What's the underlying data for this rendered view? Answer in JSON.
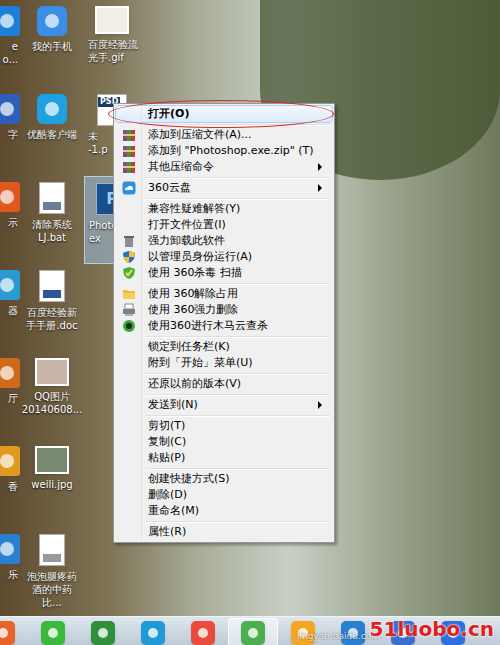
{
  "desktop": {
    "columns": [
      {
        "clipped": true,
        "items": [
          {
            "label": "e\no...",
            "kind": "app",
            "color": "#1d7fd8",
            "selected": false
          },
          {
            "label": "字",
            "kind": "app",
            "color": "#2c5fb8",
            "selected": false
          },
          {
            "label": "示",
            "kind": "app",
            "color": "#e2571e",
            "selected": false
          },
          {
            "label": "器",
            "kind": "app",
            "color": "#2a9ad1",
            "selected": false
          },
          {
            "label": "厅",
            "kind": "app",
            "color": "#d06a1a",
            "selected": false
          },
          {
            "label": "香",
            "kind": "app",
            "color": "#e09a20",
            "selected": false
          },
          {
            "label": "乐",
            "kind": "app",
            "color": "#2a7fd0",
            "selected": false
          }
        ]
      },
      {
        "clipped": false,
        "items": [
          {
            "label": "我的手机",
            "kind": "app",
            "color": "#3a8ee6",
            "selected": false
          },
          {
            "label": "优酷客户端",
            "kind": "app",
            "color": "#1fa0e0",
            "selected": false
          },
          {
            "label": "清除系统\nLJ.bat",
            "kind": "file",
            "color": "#6a7f95",
            "selected": false
          },
          {
            "label": "百度经验新\n手手册.doc",
            "kind": "file",
            "color": "#2b5797",
            "selected": false
          },
          {
            "label": "QQ图片\n20140608...",
            "kind": "image",
            "color": "#c9b6a8",
            "selected": false
          },
          {
            "label": "weili.jpg",
            "kind": "image",
            "color": "#7a8a70",
            "selected": false
          },
          {
            "label": "泡泡腿疼药\n酒的中药比...",
            "kind": "file",
            "color": "#9a9a9a",
            "selected": false
          }
        ]
      },
      {
        "clipped": false,
        "items": [
          {
            "label": "百度经验流\n光手.gif",
            "kind": "image",
            "color": "#f2efe8",
            "selected": false
          },
          {
            "label": "未\n-1.p",
            "kind": "psd",
            "badge": "PSD",
            "color": "#1b3a6b",
            "selected": false
          },
          {
            "label": "Photo\nex",
            "kind": "ps",
            "badge": "P",
            "color": "#1b4f8c",
            "selected": true
          }
        ]
      }
    ]
  },
  "context_menu": {
    "groups": [
      [
        {
          "label": "打开(O)",
          "kind": "plain",
          "submenu": false,
          "selected": true,
          "default": true,
          "annotated": true
        }
      ],
      [
        {
          "label": "添加到压缩文件(A)...",
          "kind": "rar",
          "submenu": false,
          "selected": false,
          "default": false,
          "annotated": false
        },
        {
          "label": "添加到 \"Photoshop.exe.zip\" (T)",
          "kind": "rar",
          "submenu": false,
          "selected": false,
          "default": false,
          "annotated": false
        },
        {
          "label": "其他压缩命令",
          "kind": "rar",
          "submenu": true,
          "selected": false,
          "default": false,
          "annotated": false
        }
      ],
      [
        {
          "label": "360云盘",
          "kind": "cloud",
          "submenu": true,
          "selected": false,
          "default": false,
          "annotated": false
        }
      ],
      [
        {
          "label": "兼容性疑难解答(Y)",
          "kind": "plain",
          "submenu": false,
          "selected": false,
          "default": false,
          "annotated": false
        },
        {
          "label": "打开文件位置(I)",
          "kind": "plain",
          "submenu": false,
          "selected": false,
          "default": false,
          "annotated": false
        },
        {
          "label": "强力卸载此软件",
          "kind": "trash",
          "submenu": false,
          "selected": false,
          "default": false,
          "annotated": false
        },
        {
          "label": "以管理员身份运行(A)",
          "kind": "shield",
          "submenu": false,
          "selected": false,
          "default": false,
          "annotated": false
        },
        {
          "label": "使用 360杀毒 扫描",
          "kind": "antivirus",
          "submenu": false,
          "selected": false,
          "default": false,
          "annotated": false
        }
      ],
      [
        {
          "label": "使用 360解除占用",
          "kind": "unlock",
          "submenu": false,
          "selected": false,
          "default": false,
          "annotated": false
        },
        {
          "label": "使用 360强力删除",
          "kind": "shred",
          "submenu": false,
          "selected": false,
          "default": false,
          "annotated": false
        },
        {
          "label": "使用360进行木马云查杀",
          "kind": "trojan",
          "submenu": false,
          "selected": false,
          "default": false,
          "annotated": false
        }
      ],
      [
        {
          "label": "锁定到任务栏(K)",
          "kind": "plain",
          "submenu": false,
          "selected": false,
          "default": false,
          "annotated": false
        },
        {
          "label": "附到「开始」菜单(U)",
          "kind": "plain",
          "submenu": false,
          "selected": false,
          "default": false,
          "annotated": false
        }
      ],
      [
        {
          "label": "还原以前的版本(V)",
          "kind": "plain",
          "submenu": false,
          "selected": false,
          "default": false,
          "annotated": false
        }
      ],
      [
        {
          "label": "发送到(N)",
          "kind": "plain",
          "submenu": true,
          "selected": false,
          "default": false,
          "annotated": false
        }
      ],
      [
        {
          "label": "剪切(T)",
          "kind": "plain",
          "submenu": false,
          "selected": false,
          "default": false,
          "annotated": false
        },
        {
          "label": "复制(C)",
          "kind": "plain",
          "submenu": false,
          "selected": false,
          "default": false,
          "annotated": false
        },
        {
          "label": "粘贴(P)",
          "kind": "plain",
          "submenu": false,
          "selected": false,
          "default": false,
          "annotated": false
        }
      ],
      [
        {
          "label": "创建快捷方式(S)",
          "kind": "plain",
          "submenu": false,
          "selected": false,
          "default": false,
          "annotated": false
        },
        {
          "label": "删除(D)",
          "kind": "plain",
          "submenu": false,
          "selected": false,
          "default": false,
          "annotated": false
        },
        {
          "label": "重命名(M)",
          "kind": "plain",
          "submenu": false,
          "selected": false,
          "default": false,
          "annotated": false
        }
      ],
      [
        {
          "label": "属性(R)",
          "kind": "plain",
          "submenu": false,
          "selected": false,
          "default": false,
          "annotated": false
        }
      ]
    ]
  },
  "taskbar": {
    "items": [
      {
        "color": "#e8622a",
        "selected": false
      },
      {
        "color": "#3cb93c",
        "selected": false
      },
      {
        "color": "#2f8f3a",
        "selected": false
      },
      {
        "color": "#1e9ad6",
        "selected": false
      },
      {
        "color": "#e94b3c",
        "selected": false
      },
      {
        "color": "#4caf50",
        "selected": true
      },
      {
        "color": "#f5a623",
        "selected": false
      },
      {
        "color": "#2a7fd0",
        "selected": false
      },
      {
        "color": "#3a6fd0",
        "selected": false
      },
      {
        "color": "#2e6fe0",
        "selected": false
      }
    ]
  },
  "watermark": {
    "site": "51luobo.cn",
    "faded": "jingyan.baidu.com"
  }
}
